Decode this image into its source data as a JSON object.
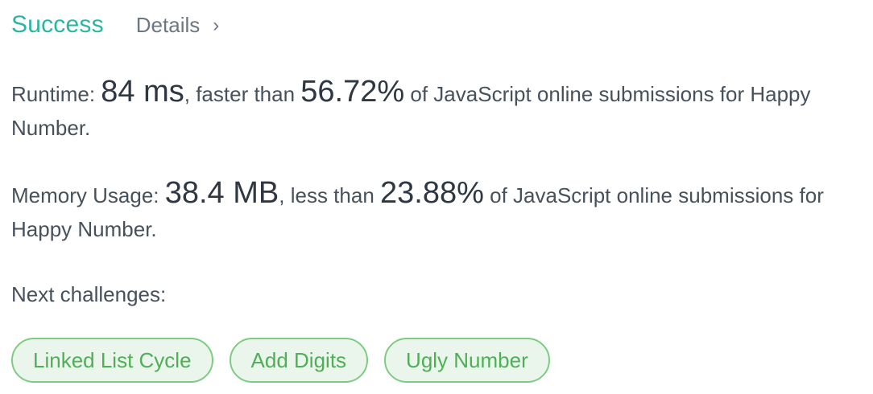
{
  "header": {
    "status": "Success",
    "details_label": "Details",
    "chevron_icon": "chevron-right-icon",
    "status_color": "#2cb5a0"
  },
  "runtime": {
    "label": "Runtime: ",
    "value": "84 ms",
    "comparison": ", faster than ",
    "percent": "56.72%",
    "suffix": " of JavaScript online submissions for Happy Number."
  },
  "memory": {
    "label": "Memory Usage: ",
    "value": "38.4 MB",
    "comparison": ", less than ",
    "percent": "23.88%",
    "suffix": " of JavaScript online submissions for Happy Number."
  },
  "next_challenges": {
    "label": "Next challenges:",
    "items": [
      "Linked List Cycle",
      "Add Digits",
      "Ugly Number"
    ],
    "chip_color": "#4fae57"
  }
}
